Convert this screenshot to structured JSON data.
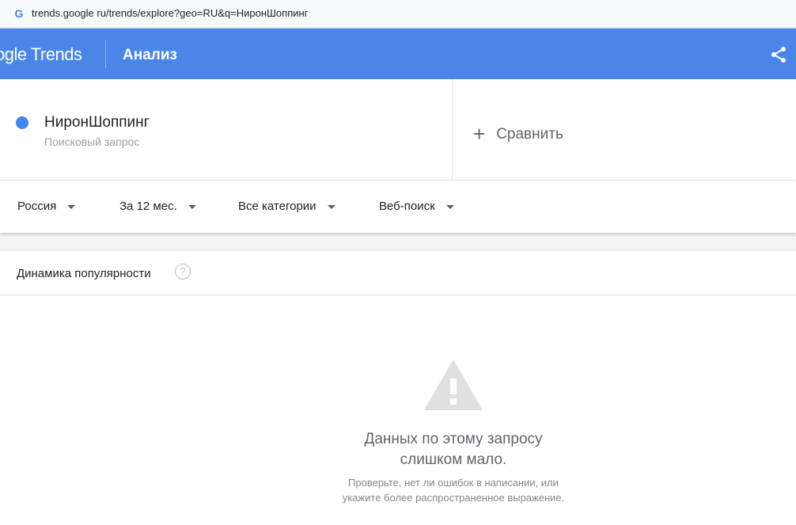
{
  "browser": {
    "favicon": "G",
    "url": "trends.google ru/trends/explore?geo=RU&q=НиронШоппинг"
  },
  "header": {
    "logo": "ogle Trends",
    "title": "Анализ",
    "share_icon": "share-icon"
  },
  "term": {
    "name": "НиронШоппинг",
    "type": "Поисковый запрос",
    "color": "#4285f4"
  },
  "compare": {
    "icon": "+",
    "label": "Сравнить"
  },
  "filters": [
    {
      "label": "Россия"
    },
    {
      "label": "За 12 мес."
    },
    {
      "label": "Все категории"
    },
    {
      "label": "Веб-поиск"
    }
  ],
  "interest_card": {
    "title": "Динамика популярности",
    "help_icon": "?",
    "empty_title_line1": "Данных по этому запросу",
    "empty_title_line2": "слишком мало.",
    "empty_sub_line1": "Проверьте, нет ли ошибок в написании, или",
    "empty_sub_line2": "укажите более распространенное выражение."
  },
  "colors": {
    "header": "#4a86e8",
    "accent": "#4285f4"
  }
}
